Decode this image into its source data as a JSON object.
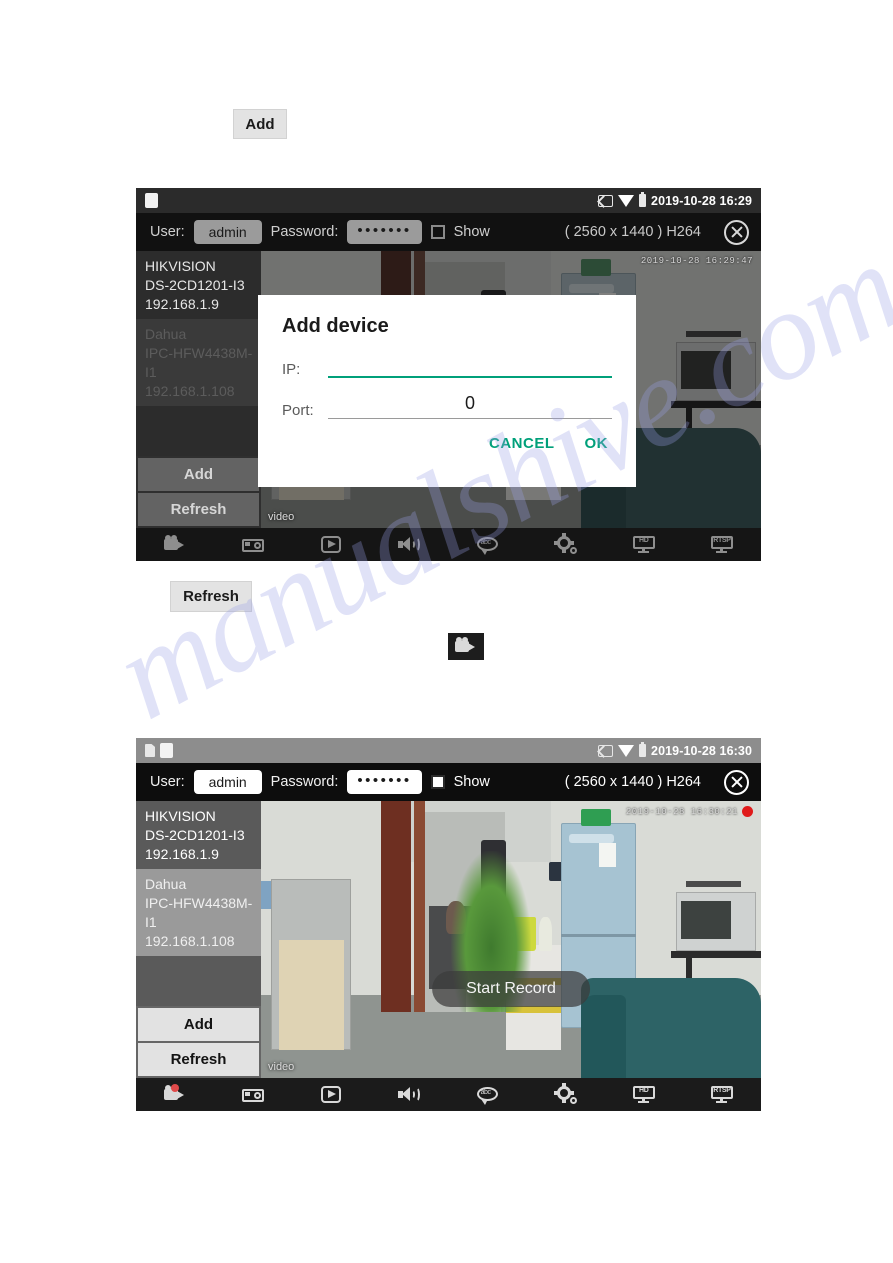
{
  "page": {
    "watermark": "manualshive.com"
  },
  "inline_controls": {
    "add_button": "Add",
    "refresh_button": "Refresh",
    "record_icon_name": "video-camera-icon"
  },
  "screenshots": [
    {
      "id": "screenshot-add-device",
      "statusbar": {
        "icons": [
          "app-square-icon",
          "cast-icon",
          "wifi-icon",
          "battery-icon"
        ],
        "datetime": "2019-10-28 16:29"
      },
      "credbar": {
        "user_label": "User:",
        "user_value": "admin",
        "password_label": "Password:",
        "password_value": "•••••••",
        "show_label": "Show",
        "show_checked": false,
        "resolution": "( 2560 x 1440 ) H264",
        "close_icon_name": "close-circle-icon"
      },
      "sidebar": {
        "devices": [
          {
            "brand": "HIKVISION",
            "model": "DS-2CD1201-I3",
            "ip": "192.168.1.9",
            "selected": true
          },
          {
            "brand": "Dahua",
            "model": "IPC-HFW4438M-I1",
            "ip": "192.168.1.108",
            "selected": false
          }
        ],
        "add_button": "Add",
        "refresh_button": "Refresh"
      },
      "video": {
        "timestamp_overlay": "2019-10-28 16:29:47",
        "tag": "video",
        "recording": false,
        "toast": null
      },
      "toolbar": [
        {
          "name": "video-camera-icon",
          "label": "Record"
        },
        {
          "name": "photo-camera-icon",
          "label": "Snapshot"
        },
        {
          "name": "play-icon",
          "label": "Playback"
        },
        {
          "name": "speaker-icon",
          "label": "Audio"
        },
        {
          "name": "chat-bubble-icon",
          "label": "Talk"
        },
        {
          "name": "gear-icon",
          "label": "Settings"
        },
        {
          "name": "monitor-hd-icon",
          "label": "HD"
        },
        {
          "name": "monitor-rtsp-icon",
          "label": "RTSP"
        }
      ],
      "dialog": {
        "title": "Add device",
        "ip_label": "IP:",
        "ip_value": "",
        "port_label": "Port:",
        "port_value": "0",
        "cancel_button": "CANCEL",
        "ok_button": "OK",
        "accent_color": "#00a07a"
      }
    },
    {
      "id": "screenshot-recording",
      "statusbar": {
        "icons": [
          "sd-card-icon",
          "app-square-icon",
          "cast-icon",
          "wifi-icon",
          "battery-icon"
        ],
        "datetime": "2019-10-28 16:30"
      },
      "credbar": {
        "user_label": "User:",
        "user_value": "admin",
        "password_label": "Password:",
        "password_value": "•••••••",
        "show_label": "Show",
        "show_checked": false,
        "resolution": "( 2560 x 1440 ) H264",
        "close_icon_name": "close-circle-icon"
      },
      "sidebar": {
        "devices": [
          {
            "brand": "HIKVISION",
            "model": "DS-2CD1201-I3",
            "ip": "192.168.1.9",
            "selected": true
          },
          {
            "brand": "Dahua",
            "model": "IPC-HFW4438M-I1",
            "ip": "192.168.1.108",
            "selected": false
          }
        ],
        "add_button": "Add",
        "refresh_button": "Refresh"
      },
      "video": {
        "timestamp_overlay": "2019-10-28 16:30:21",
        "tag": "video",
        "recording": true,
        "toast": "Start Record"
      },
      "toolbar": [
        {
          "name": "video-camera-icon",
          "label": "Record"
        },
        {
          "name": "photo-camera-icon",
          "label": "Snapshot"
        },
        {
          "name": "play-icon",
          "label": "Playback"
        },
        {
          "name": "speaker-icon",
          "label": "Audio"
        },
        {
          "name": "chat-bubble-icon",
          "label": "Talk"
        },
        {
          "name": "gear-icon",
          "label": "Settings"
        },
        {
          "name": "monitor-hd-icon",
          "label": "HD"
        },
        {
          "name": "monitor-rtsp-icon",
          "label": "RTSP"
        }
      ],
      "dialog": null
    }
  ],
  "toolbar_glyph_text": {
    "chat": "abc",
    "hd": "HD",
    "rtsp": "RTSP"
  }
}
